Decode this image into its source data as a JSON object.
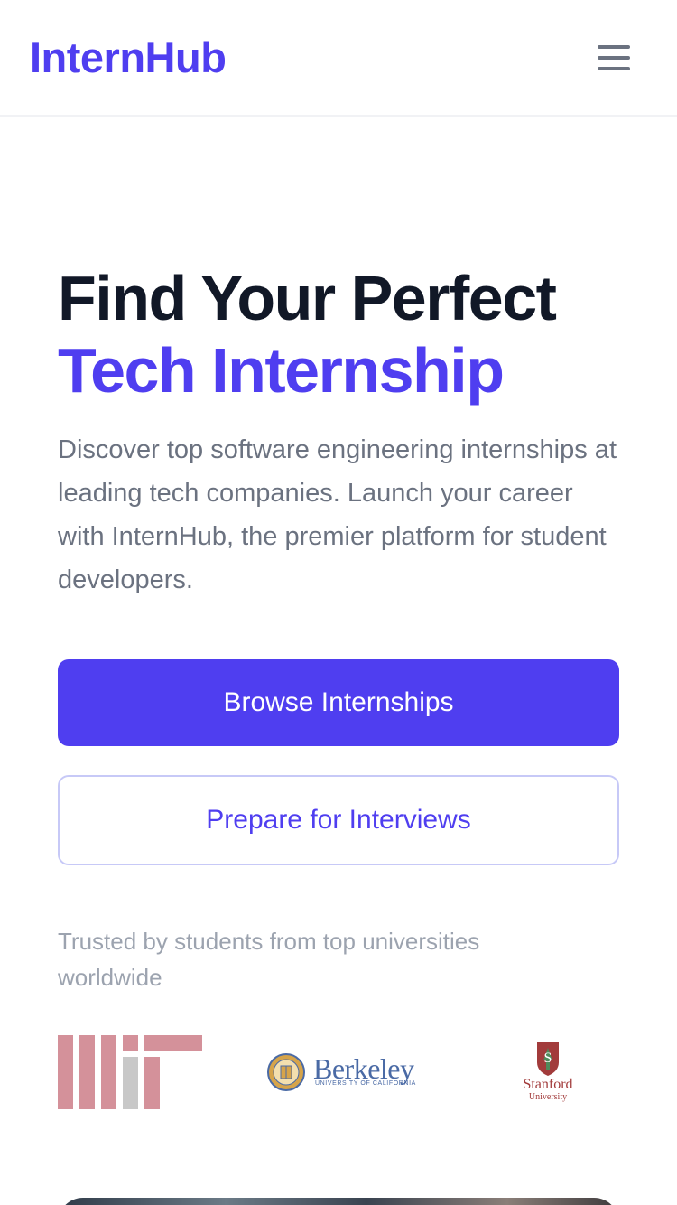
{
  "header": {
    "logo_text": "InternHub",
    "menu_icon": "hamburger-menu-icon"
  },
  "hero": {
    "title_line1": "Find Your Perfect",
    "title_line2": "Tech Internship",
    "description": "Discover top software engineering internships at leading tech companies. Launch your career with InternHub, the premier platform for student developers."
  },
  "actions": {
    "primary_label": "Browse Internships",
    "secondary_label": "Prepare for Interviews"
  },
  "trust": {
    "text": "Trusted by students from top universities worldwide",
    "logos": [
      {
        "icon": "mit-logo"
      },
      {
        "icon": "berkeley-logo",
        "name": "Berkeley",
        "subtitle": "UNIVERSITY OF CALIFORNIA"
      },
      {
        "icon": "stanford-logo",
        "name": "Stanford",
        "subtitle": "University"
      }
    ]
  },
  "colors": {
    "brand": "#4f3ef0",
    "heading": "#111827",
    "body_text": "#6b7280",
    "muted_text": "#9ca3af",
    "secondary_border": "#c7c9f7",
    "mit_red": "#d4919a",
    "mit_gray": "#c8c8c8",
    "berkeley_blue": "#4a6aa5",
    "berkeley_gold": "#d6a44a",
    "stanford_red": "#a23b3b"
  }
}
